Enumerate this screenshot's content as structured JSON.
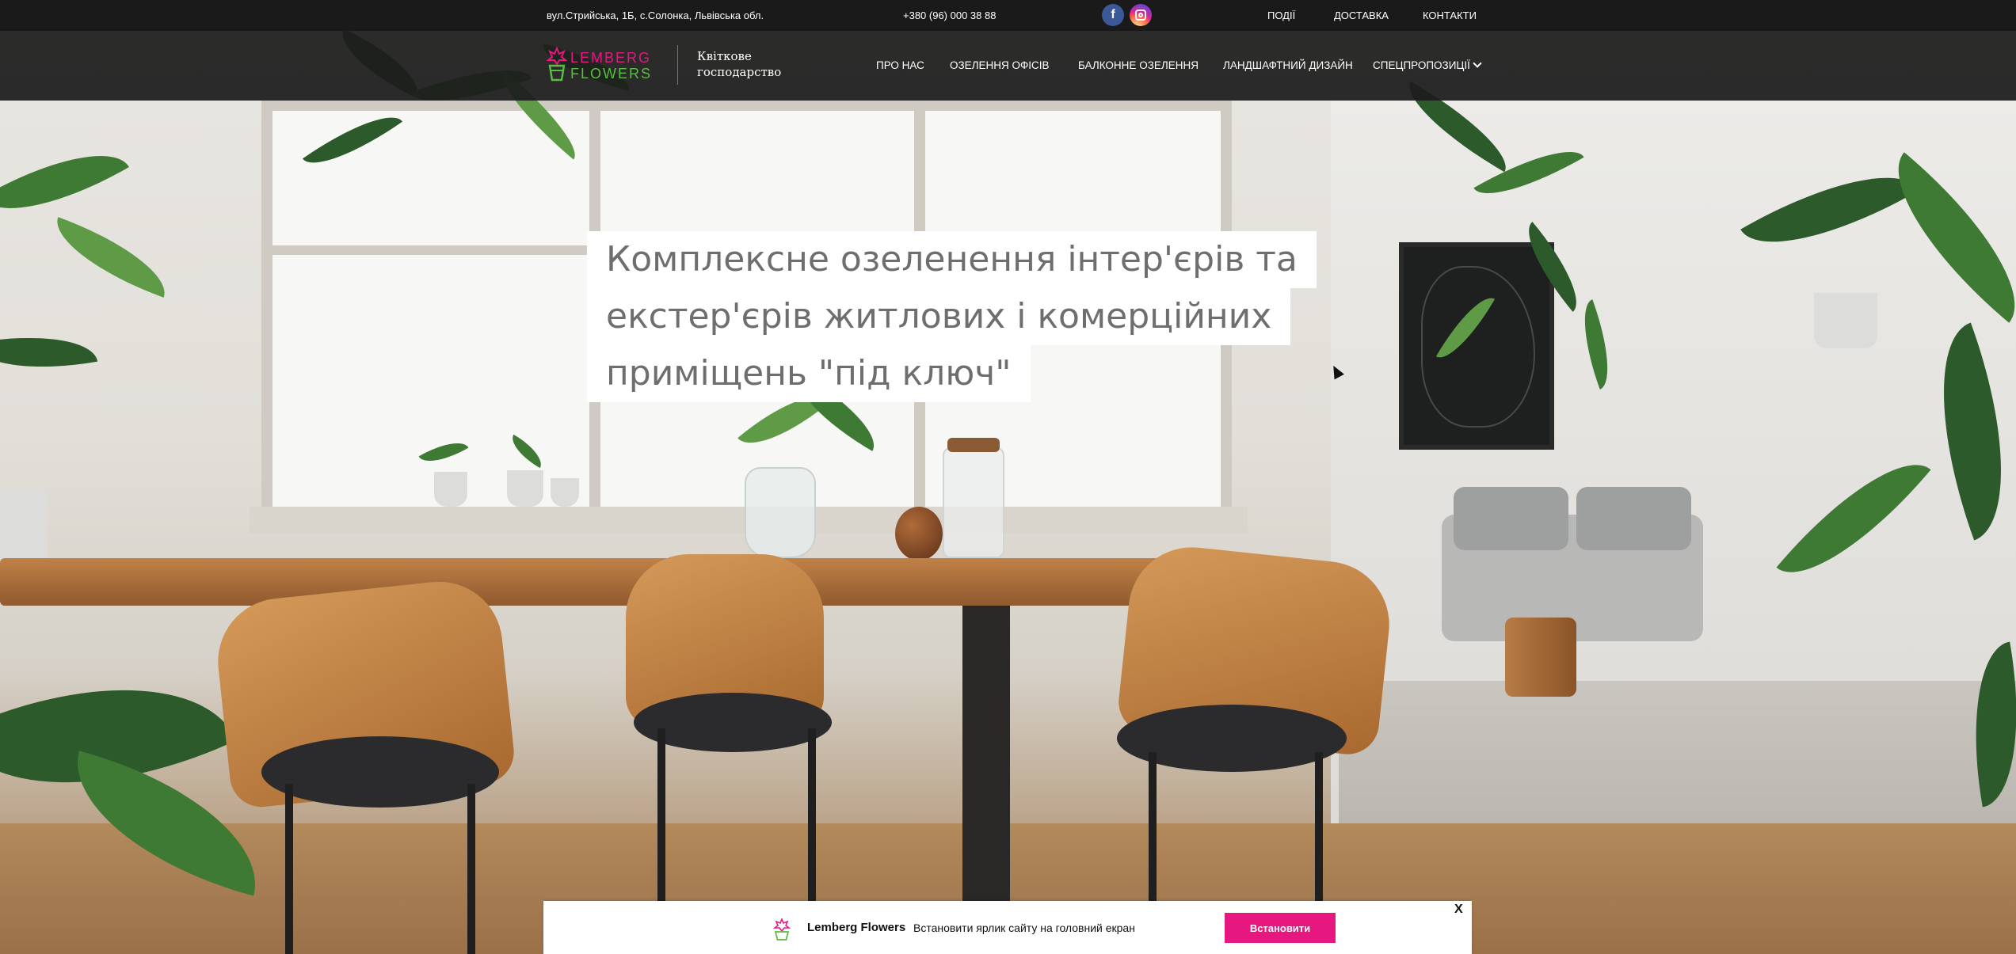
{
  "topbar": {
    "address": "вул.Стрийська, 1Б, с.Солонка, Львівська обл.",
    "phone": "+380 (96) 000 38 88",
    "social": {
      "facebook_icon": "facebook-icon",
      "facebook_glyph": "f",
      "instagram_icon": "instagram-icon"
    },
    "links": [
      "ПОДІЇ",
      "ДОСТАВКА",
      "КОНТАКТИ"
    ]
  },
  "header": {
    "logo_word1": "LEMBERG",
    "logo_word2": "FLOWERS",
    "tagline_line1": "Квіткове",
    "tagline_line2": "господарство",
    "nav": [
      "ПРО НАС",
      "ОЗЕЛЕННЯ ОФІСІВ",
      "БАЛКОННЕ ОЗЕЛЕННЯ",
      "ЛАНДШАФТНИЙ ДИЗАЙН",
      "СПЕЦПРОПОЗИЦІЇ"
    ]
  },
  "hero": {
    "title_lines": [
      "Комплексне озеленення інтер'єрів та",
      "екстер'єрів житлових і комерційних",
      "приміщень \"під ключ\""
    ]
  },
  "install_banner": {
    "app_name": "Lemberg Flowers",
    "message": "Встановити ярлик сайту на головний екран",
    "button_label": "Встановити",
    "close_label": "X"
  },
  "colors": {
    "brand_pink": "#e6177f",
    "brand_green": "#5bbd45",
    "header_bg": "#1a1a1a"
  }
}
